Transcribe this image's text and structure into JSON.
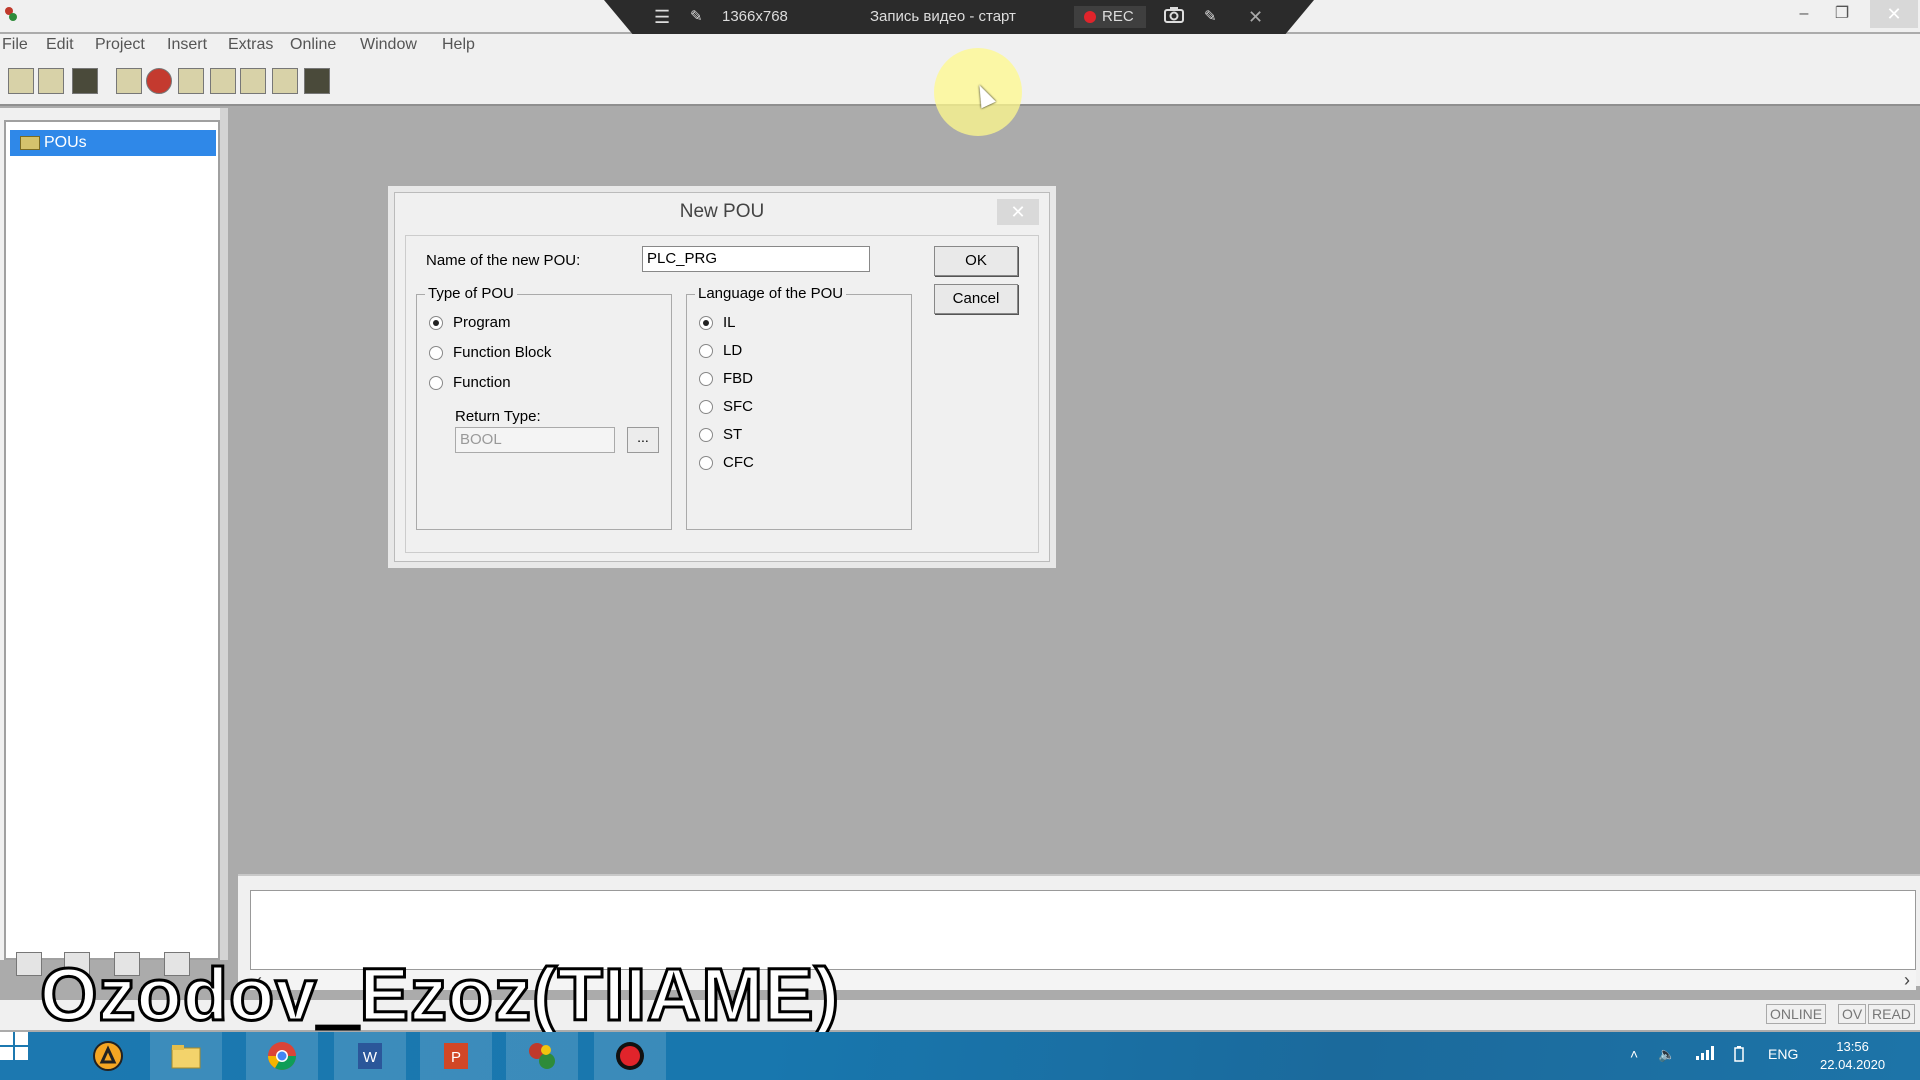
{
  "recorder": {
    "menu_icon": "menu-icon",
    "pin_icon": "pin-icon",
    "resolution": "1366x768",
    "title": "Запись видео - старт",
    "rec_label": "REC",
    "camera_icon": "camera-icon",
    "pen_icon": "pen-icon",
    "close_symbol": "✕"
  },
  "window": {
    "minimize": "–",
    "restore": "❐",
    "close": "✕"
  },
  "menu": [
    "File",
    "Edit",
    "Project",
    "Insert",
    "Extras",
    "Online",
    "Window",
    "Help"
  ],
  "toolbar": {
    "buttons": [
      "new-icon",
      "open-icon",
      "save-icon",
      "print-icon",
      "stop-icon",
      "build-icon",
      "copy-icon",
      "transfer-icon",
      "download-icon",
      "login-icon"
    ]
  },
  "tree": {
    "root": "POUs"
  },
  "dialog": {
    "title": "New POU",
    "close": "✕",
    "name_label": "Name of the new POU:",
    "name_value": "PLC_PRG",
    "ok": "OK",
    "cancel": "Cancel",
    "type_group": {
      "title": "Type of POU",
      "options": [
        {
          "label": "Program",
          "selected": true
        },
        {
          "label": "Function Block",
          "selected": false
        },
        {
          "label": "Function",
          "selected": false
        }
      ],
      "return_type_label": "Return Type:",
      "return_type_value": "BOOL",
      "browse": "..."
    },
    "lang_group": {
      "title": "Language of the POU",
      "options": [
        {
          "label": "IL",
          "selected": true
        },
        {
          "label": "LD",
          "selected": false
        },
        {
          "label": "FBD",
          "selected": false
        },
        {
          "label": "SFC",
          "selected": false
        },
        {
          "label": "ST",
          "selected": false
        },
        {
          "label": "CFC",
          "selected": false
        }
      ]
    }
  },
  "statusbar": {
    "online": "ONLINE",
    "ov": "OV",
    "read": "READ"
  },
  "watermark": "Ozodov_Ezoz(TIIAME)",
  "scroll": {
    "left": "‹",
    "right": "›"
  },
  "taskbar": {
    "apps": [
      "start-icon",
      "avast-icon",
      "explorer-icon",
      "chrome-icon",
      "word-icon",
      "powerpoint-icon",
      "codesys-icon",
      "record-icon"
    ],
    "tray": {
      "chevron": "˄",
      "volume": "🔈",
      "lang": "ENG"
    },
    "time": "13:56",
    "date": "22.04.2020"
  }
}
